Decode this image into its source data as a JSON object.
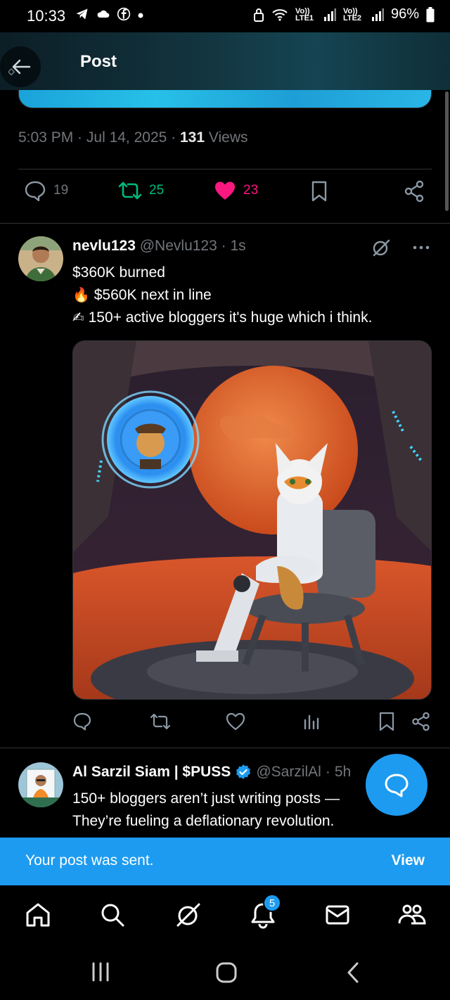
{
  "status_bar": {
    "time": "10:33",
    "left_icons": [
      "telegram-icon",
      "cloud-icon",
      "facebook-icon",
      "dot-icon"
    ],
    "sim1_label": "Vo)) LTE1",
    "sim2_label": "Vo)) LTE2",
    "battery": "96%"
  },
  "header": {
    "title": "Post"
  },
  "post_meta": {
    "time": "5:03 PM",
    "date": "Jul 14, 2025",
    "views_count": "131",
    "views_label": "Views"
  },
  "post_stats": {
    "replies": "19",
    "reposts": "25",
    "likes": "23"
  },
  "tweet1": {
    "name": "nevlu123",
    "handle": "@Nevlu123",
    "time": "1s",
    "lines": [
      "$360K burned",
      "$560K next in line",
      "150+ active bloggers it's huge which i think."
    ],
    "emojis": [
      "🔥",
      "✍"
    ]
  },
  "tweet2": {
    "name": "Al Sarzil Siam | $PUSS",
    "handle": "@SarzilAl",
    "time": "5h",
    "lines": [
      "150+ bloggers aren’t just writing posts —",
      "They’re fueling a deflationary revolution."
    ]
  },
  "toast": {
    "message": "Your post was sent.",
    "action": "View"
  },
  "nav": {
    "notifications_badge": "5"
  },
  "colors": {
    "accent": "#1d9bf0",
    "repost": "#00ba7c",
    "like": "#f91880",
    "muted": "#71767b"
  }
}
